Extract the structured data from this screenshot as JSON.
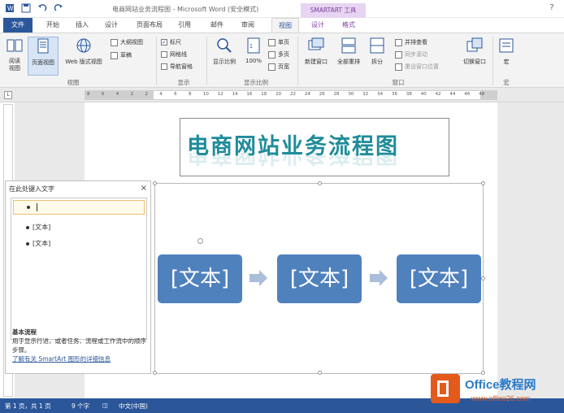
{
  "title_bar": {
    "doc_title": "电商网站业务流程图 - Microsoft Word (安全模式)",
    "context_header": "SMARTART 工具",
    "help": "?"
  },
  "qat": {
    "save_icon": "save-icon",
    "undo_icon": "undo-icon",
    "redo_icon": "redo-icon"
  },
  "tabs": {
    "file": "文件",
    "home": "开始",
    "insert": "插入",
    "design": "设计",
    "layout": "页面布局",
    "references": "引用",
    "mailings": "邮件",
    "review": "审阅",
    "view": "视图",
    "sa_design": "设计",
    "sa_format": "格式"
  },
  "ribbon": {
    "views": {
      "read_mode": "阅读\n视图",
      "print_layout": "页面视图",
      "web_layout": "Web 版式视图",
      "outline": "大纲视图",
      "draft": "草稿",
      "label": "视图"
    },
    "show": {
      "ruler": "标尺",
      "gridlines": "网格线",
      "nav_pane": "导航窗格",
      "label": "显示",
      "ruler_checked": "✓"
    },
    "zoom": {
      "zoom": "显示比例",
      "hundred": "100%",
      "one_page": "单页",
      "multi_page": "多页",
      "page_width": "页宽",
      "label": "显示比例"
    },
    "window": {
      "new_window": "新建窗口",
      "arrange_all": "全部重排",
      "split": "拆分",
      "side_by_side": "并排查看",
      "sync_scroll": "同步滚动",
      "reset_pos": "重设窗口位置",
      "switch_windows": "切换窗口",
      "label": "窗口"
    },
    "macros": {
      "macros": "宏",
      "label": "宏"
    }
  },
  "ruler": {
    "corner": "L",
    "ticks": [
      "8",
      "6",
      "4",
      "2",
      "2",
      "4",
      "6",
      "8",
      "10",
      "12",
      "14",
      "16",
      "18",
      "20",
      "22",
      "24",
      "26",
      "28",
      "30",
      "32",
      "34",
      "36",
      "38",
      "40",
      "42",
      "44",
      "46",
      "48"
    ]
  },
  "document": {
    "title_text": "电商网站业务流程图",
    "boxes": [
      "[文本]",
      "[文本]",
      "[文本]"
    ]
  },
  "text_pane": {
    "header": "在此处键入文字",
    "close": "×",
    "items": [
      "",
      "[文本]",
      "[文本]"
    ],
    "desc_title": "基本流程",
    "desc_body": "用于显示行进，或者任务、流程或工作流中的顺序步骤。",
    "link": "了解有关 SmartArt 图形的详细信息"
  },
  "status_bar": {
    "page": "第 1 页，共 1 页",
    "words": "9 个字",
    "lang": "中文(中国)"
  },
  "watermark": {
    "brand": "Office教程网",
    "url": "www.office26.com"
  },
  "colors": {
    "accent": "#2b579a",
    "smartart_box": "#4f81bd",
    "title_teal": "#1f8c9a",
    "context_tab": "#7a3f9c"
  }
}
